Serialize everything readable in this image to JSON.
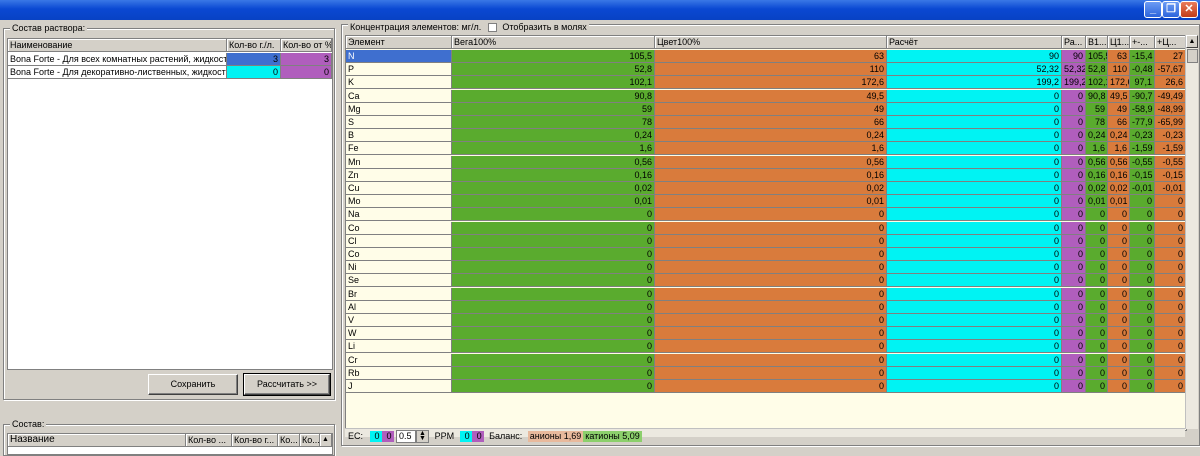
{
  "window": {
    "minimize": "_",
    "restore": "❐",
    "close": "✕"
  },
  "colors": {
    "green": "#5aab2e",
    "orange": "#d97b3c",
    "cyan": "#00f3f3",
    "purple": "#b05ebd",
    "blue_sel": "#3f6fcf",
    "hdr": "#d4d0c8",
    "yellowish": "#fffde8"
  },
  "solution_group": {
    "title": "Состав раствора:",
    "headers": [
      "Наименование",
      "Кол-во г./л.",
      "Кол-во от %"
    ],
    "rows": [
      {
        "name": "Bona Forte - Для всех комнатных растений, жидкост",
        "qty": "3",
        "pct": "3"
      },
      {
        "name": "Bona Forte - Для декоративно-лиственных, жидкост",
        "qty": "0",
        "pct": "0"
      }
    ],
    "save_label": "Сохранить",
    "calc_label": "Рассчитать >>"
  },
  "composition_group": {
    "title": "Состав:",
    "headers": [
      "Название",
      "Кол-во ...",
      "Кол-во г...",
      "Ко...",
      "Ко..."
    ]
  },
  "concentration": {
    "title": "Концентрация элементов: мг/л.",
    "moles_label": "Отобразить в молях",
    "headers": [
      "Элемент",
      "Вега100%",
      "Цвет100%",
      "Расчёт",
      "Ра...",
      "В1...",
      "Ц1...",
      "+-...",
      "+Ц..."
    ],
    "rows": [
      {
        "el": "N",
        "vega": "105,5",
        "cvet": "63",
        "calc": "90",
        "ra": "90",
        "b1": "105,5",
        "c1": "63",
        "pm": "-15,4",
        "pc": "27"
      },
      {
        "el": "P",
        "vega": "52,8",
        "cvet": "110",
        "calc": "52,32",
        "ra": "52,32",
        "b1": "52,8",
        "c1": "110",
        "pm": "-0,48",
        "pc": "-57,67"
      },
      {
        "el": "K",
        "vega": "102,1",
        "cvet": "172,6",
        "calc": "199,2",
        "ra": "199,2",
        "b1": "102,1",
        "c1": "172,6",
        "pm": "97,1",
        "pc": "26,6"
      },
      {
        "el": "Ca",
        "vega": "90,8",
        "cvet": "49,5",
        "calc": "0",
        "ra": "0",
        "b1": "90,8",
        "c1": "49,5",
        "pm": "-90,7",
        "pc": "-49,49"
      },
      {
        "el": "Mg",
        "vega": "59",
        "cvet": "49",
        "calc": "0",
        "ra": "0",
        "b1": "59",
        "c1": "49",
        "pm": "-58,9",
        "pc": "-48,99"
      },
      {
        "el": "S",
        "vega": "78",
        "cvet": "66",
        "calc": "0",
        "ra": "0",
        "b1": "78",
        "c1": "66",
        "pm": "-77,9",
        "pc": "-65,99"
      },
      {
        "el": "B",
        "vega": "0,24",
        "cvet": "0,24",
        "calc": "0",
        "ra": "0",
        "b1": "0,24",
        "c1": "0,24",
        "pm": "-0,23",
        "pc": "-0,23"
      },
      {
        "el": "Fe",
        "vega": "1,6",
        "cvet": "1,6",
        "calc": "0",
        "ra": "0",
        "b1": "1,6",
        "c1": "1,6",
        "pm": "-1,59",
        "pc": "-1,59"
      },
      {
        "el": "Mn",
        "vega": "0,56",
        "cvet": "0,56",
        "calc": "0",
        "ra": "0",
        "b1": "0,56",
        "c1": "0,56",
        "pm": "-0,55",
        "pc": "-0,55"
      },
      {
        "el": "Zn",
        "vega": "0,16",
        "cvet": "0,16",
        "calc": "0",
        "ra": "0",
        "b1": "0,16",
        "c1": "0,16",
        "pm": "-0,15",
        "pc": "-0,15"
      },
      {
        "el": "Cu",
        "vega": "0,02",
        "cvet": "0,02",
        "calc": "0",
        "ra": "0",
        "b1": "0,02",
        "c1": "0,02",
        "pm": "-0,01",
        "pc": "-0,01"
      },
      {
        "el": "Mo",
        "vega": "0,01",
        "cvet": "0,01",
        "calc": "0",
        "ra": "0",
        "b1": "0,01",
        "c1": "0,01",
        "pm": "0",
        "pc": "0"
      },
      {
        "el": "Na",
        "vega": "0",
        "cvet": "0",
        "calc": "0",
        "ra": "0",
        "b1": "0",
        "c1": "0",
        "pm": "0",
        "pc": "0"
      },
      {
        "el": "Co",
        "vega": "0",
        "cvet": "0",
        "calc": "0",
        "ra": "0",
        "b1": "0",
        "c1": "0",
        "pm": "0",
        "pc": "0"
      },
      {
        "el": "Cl",
        "vega": "0",
        "cvet": "0",
        "calc": "0",
        "ra": "0",
        "b1": "0",
        "c1": "0",
        "pm": "0",
        "pc": "0"
      },
      {
        "el": "Co",
        "vega": "0",
        "cvet": "0",
        "calc": "0",
        "ra": "0",
        "b1": "0",
        "c1": "0",
        "pm": "0",
        "pc": "0"
      },
      {
        "el": "Ni",
        "vega": "0",
        "cvet": "0",
        "calc": "0",
        "ra": "0",
        "b1": "0",
        "c1": "0",
        "pm": "0",
        "pc": "0"
      },
      {
        "el": "Se",
        "vega": "0",
        "cvet": "0",
        "calc": "0",
        "ra": "0",
        "b1": "0",
        "c1": "0",
        "pm": "0",
        "pc": "0"
      },
      {
        "el": "Br",
        "vega": "0",
        "cvet": "0",
        "calc": "0",
        "ra": "0",
        "b1": "0",
        "c1": "0",
        "pm": "0",
        "pc": "0"
      },
      {
        "el": "Al",
        "vega": "0",
        "cvet": "0",
        "calc": "0",
        "ra": "0",
        "b1": "0",
        "c1": "0",
        "pm": "0",
        "pc": "0"
      },
      {
        "el": "V",
        "vega": "0",
        "cvet": "0",
        "calc": "0",
        "ra": "0",
        "b1": "0",
        "c1": "0",
        "pm": "0",
        "pc": "0"
      },
      {
        "el": "W",
        "vega": "0",
        "cvet": "0",
        "calc": "0",
        "ra": "0",
        "b1": "0",
        "c1": "0",
        "pm": "0",
        "pc": "0"
      },
      {
        "el": "Li",
        "vega": "0",
        "cvet": "0",
        "calc": "0",
        "ra": "0",
        "b1": "0",
        "c1": "0",
        "pm": "0",
        "pc": "0"
      },
      {
        "el": "Cr",
        "vega": "0",
        "cvet": "0",
        "calc": "0",
        "ra": "0",
        "b1": "0",
        "c1": "0",
        "pm": "0",
        "pc": "0"
      },
      {
        "el": "Rb",
        "vega": "0",
        "cvet": "0",
        "calc": "0",
        "ra": "0",
        "b1": "0",
        "c1": "0",
        "pm": "0",
        "pc": "0"
      },
      {
        "el": "J",
        "vega": "0",
        "cvet": "0",
        "calc": "0",
        "ra": "0",
        "b1": "0",
        "c1": "0",
        "pm": "0",
        "pc": "0"
      }
    ]
  },
  "status": {
    "ec_label": "EC:",
    "ec_a": "0",
    "ec_b": "0",
    "ec_step": "0.5",
    "ppm_label": "PPM",
    "ppm_a": "0",
    "ppm_b": "0",
    "balance_label": "Баланс:",
    "anions": "анионы 1,69",
    "cations": "катионы 5,09"
  }
}
